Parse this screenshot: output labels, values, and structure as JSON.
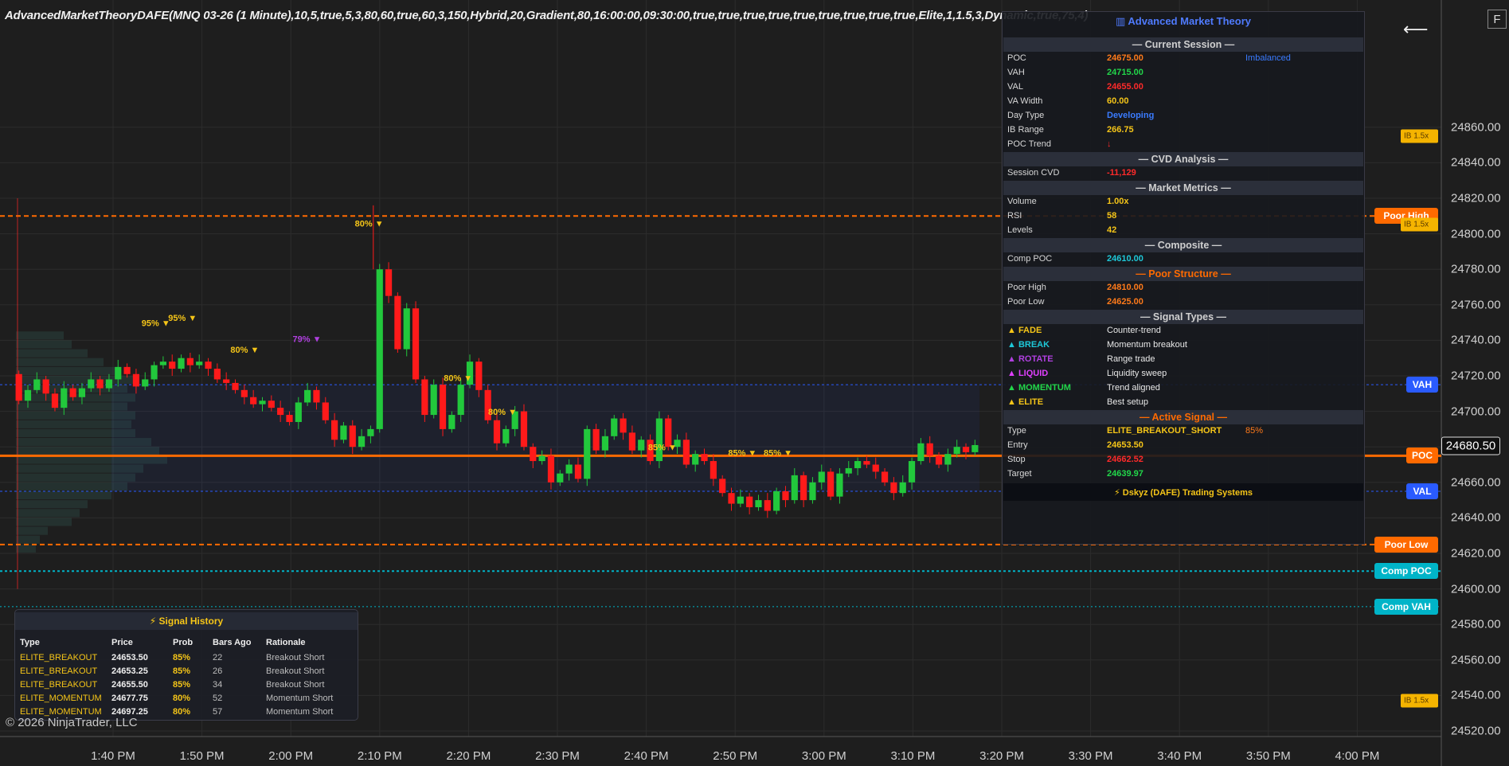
{
  "title": "AdvancedMarketTheoryDAFE(MNQ 03-26 (1 Minute),10,5,true,5,3,80,60,true,60,3,150,Hybrid,20,Gradient,80,16:00:00,09:30:00,true,true,true,true,true,true,true,true,true,Elite,1,1.5,3,Dynamic,true,75,4)",
  "copyright": "© 2026 NinjaTrader, LLC",
  "corner_button": "F",
  "time_axis": [
    "1:40 PM",
    "1:50 PM",
    "2:00 PM",
    "2:10 PM",
    "2:20 PM",
    "2:30 PM",
    "2:40 PM",
    "2:50 PM",
    "3:00 PM",
    "3:10 PM",
    "3:20 PM",
    "3:30 PM",
    "3:40 PM",
    "3:50 PM",
    "4:00 PM"
  ],
  "price_axis": [
    "24860.00",
    "24840.00",
    "24820.00",
    "24800.00",
    "24780.00",
    "24760.00",
    "24740.00",
    "24720.00",
    "24700.00",
    "24680.00",
    "24660.00",
    "24640.00",
    "24620.00",
    "24600.00",
    "24580.00",
    "24560.00",
    "24540.00",
    "24520.00"
  ],
  "last_price": "24680.50",
  "right_labels": [
    {
      "text": "Poor High",
      "price": 24810,
      "color": "#ff6a00"
    },
    {
      "text": "VAH",
      "price": 24715,
      "color": "#2a5bff"
    },
    {
      "text": "POC",
      "price": 24675,
      "color": "#ff6a00"
    },
    {
      "text": "VAL",
      "price": 24655,
      "color": "#2a5bff"
    },
    {
      "text": "Poor Low",
      "price": 24625,
      "color": "#ff6a00"
    },
    {
      "text": "Comp POC",
      "price": 24610,
      "color": "#00b4c8"
    },
    {
      "text": "Comp VAH",
      "price": 24590,
      "color": "#00b4c8"
    }
  ],
  "ib_labels": [
    {
      "text": "IB 1.5x",
      "price": 24855
    },
    {
      "text": "IB 1.5x",
      "price": 24805
    },
    {
      "text": "IB 1.5x",
      "price": 24537
    }
  ],
  "signal_markers": [
    {
      "text": "95% ▼",
      "price": 24748,
      "t": "1:45",
      "color": "#f5c518"
    },
    {
      "text": "95% ▼",
      "price": 24751,
      "t": "1:48",
      "color": "#f5c518"
    },
    {
      "text": "80% ▼",
      "price": 24733,
      "t": "1:55",
      "color": "#f5c518"
    },
    {
      "text": "79% ▼",
      "price": 24739,
      "t": "2:02",
      "color": "#b040e0"
    },
    {
      "text": "80% ▼",
      "price": 24804,
      "t": "2:09",
      "color": "#f5c518"
    },
    {
      "text": "80% ▼",
      "price": 24717,
      "t": "2:19",
      "color": "#f5c518"
    },
    {
      "text": "80% ▼",
      "price": 24698,
      "t": "2:24",
      "color": "#f5c518"
    },
    {
      "text": "85% ▼",
      "price": 24678,
      "t": "2:42",
      "color": "#f5c518"
    },
    {
      "text": "85% ▼",
      "price": 24675,
      "t": "2:51",
      "color": "#f5c518"
    },
    {
      "text": "85% ▼",
      "price": 24675,
      "t": "2:55",
      "color": "#f5c518"
    }
  ],
  "levels": {
    "poor_high": 24810,
    "poor_low": 24625,
    "vah": 24715,
    "val": 24655,
    "poc": 24675,
    "comp_poc": 24610,
    "comp_vah": 24590
  },
  "panel": {
    "title": "▥ Advanced Market Theory",
    "rows": [
      {
        "type": "section",
        "label": "— Current Session —",
        "color": "#cfcfcf"
      },
      {
        "k": "POC",
        "v": "24675.00",
        "vc": "#ff7a1a",
        "x": "Imbalanced",
        "xc": "#3a7bff"
      },
      {
        "k": "VAH",
        "v": "24715.00",
        "vc": "#22d64a"
      },
      {
        "k": "VAL",
        "v": "24655.00",
        "vc": "#ff2a2a"
      },
      {
        "k": "VA Width",
        "v": "60.00",
        "vc": "#f5c518"
      },
      {
        "k": "Day Type",
        "v": "Developing",
        "vc": "#3a7bff"
      },
      {
        "k": "IB Range",
        "v": "266.75",
        "vc": "#f5c518"
      },
      {
        "k": "POC Trend",
        "v": "↓",
        "vc": "#ff2a2a"
      },
      {
        "type": "section",
        "label": "— CVD Analysis —",
        "color": "#cfcfcf"
      },
      {
        "k": "Session CVD",
        "v": "-11,129",
        "vc": "#ff2a2a"
      },
      {
        "type": "section",
        "label": "— Market Metrics —",
        "color": "#cfcfcf"
      },
      {
        "k": "Volume",
        "v": "1.00x",
        "vc": "#f5c518"
      },
      {
        "k": "RSI",
        "v": "58",
        "vc": "#f5c518"
      },
      {
        "k": "Levels",
        "v": "42",
        "vc": "#f5c518"
      },
      {
        "type": "section",
        "label": "— Composite —",
        "color": "#cfcfcf"
      },
      {
        "k": "Comp POC",
        "v": "24610.00",
        "vc": "#1ec8d8"
      },
      {
        "type": "section",
        "label": "— Poor Structure —",
        "color": "#ff6a00"
      },
      {
        "k": "Poor High",
        "v": "24810.00",
        "vc": "#ff7a1a"
      },
      {
        "k": "Poor Low",
        "v": "24625.00",
        "vc": "#ff7a1a"
      },
      {
        "type": "section",
        "label": "— Signal Types —",
        "color": "#cfcfcf"
      },
      {
        "k": "▲ FADE",
        "kc": "#f5c518",
        "v": "Counter-trend",
        "vc": "#e8e8e8",
        "plain": true
      },
      {
        "k": "▲ BREAK",
        "kc": "#1ec8d8",
        "v": "Momentum breakout",
        "vc": "#e8e8e8",
        "plain": true
      },
      {
        "k": "▲ ROTATE",
        "kc": "#b040e0",
        "v": "Range trade",
        "vc": "#e8e8e8",
        "plain": true
      },
      {
        "k": "▲ LIQUID",
        "kc": "#e040ff",
        "v": "Liquidity sweep",
        "vc": "#e8e8e8",
        "plain": true
      },
      {
        "k": "▲ MOMENTUM",
        "kc": "#22d64a",
        "v": "Trend aligned",
        "vc": "#e8e8e8",
        "plain": true
      },
      {
        "k": "▲ ELITE",
        "kc": "#f5c518",
        "v": "Best setup",
        "vc": "#e8e8e8",
        "plain": true
      },
      {
        "type": "section",
        "label": "— Active Signal —",
        "color": "#ff6a00"
      },
      {
        "k": "Type",
        "v": "ELITE_BREAKOUT_SHORT",
        "vc": "#f5c518",
        "x": "85%",
        "xc": "#ff7a1a"
      },
      {
        "k": "Entry",
        "v": "24653.50",
        "vc": "#f5c518"
      },
      {
        "k": "Stop",
        "v": "24662.52",
        "vc": "#ff2a2a"
      },
      {
        "k": "Target",
        "v": "24639.97",
        "vc": "#22d64a"
      }
    ],
    "footer": "⚡ Dskyz (DAFE) Trading Systems"
  },
  "history": {
    "title": "⚡ Signal History",
    "columns": [
      "Type",
      "Price",
      "Prob",
      "Bars Ago",
      "Rationale"
    ],
    "rows": [
      [
        "ELITE_BREAKOUT",
        "24653.50",
        "85%",
        "22",
        "Breakout Short"
      ],
      [
        "ELITE_BREAKOUT",
        "24653.25",
        "85%",
        "26",
        "Breakout Short"
      ],
      [
        "ELITE_BREAKOUT",
        "24655.50",
        "85%",
        "34",
        "Breakout Short"
      ],
      [
        "ELITE_MOMENTUM",
        "24677.75",
        "80%",
        "52",
        "Momentum Short"
      ],
      [
        "ELITE_MOMENTUM",
        "24697.25",
        "80%",
        "57",
        "Momentum Short"
      ]
    ]
  },
  "colors": {
    "up": "#22c83c",
    "down": "#ff1a1a",
    "grid": "#2c2c2c",
    "accent": "#ff6a00",
    "value_area": "#2a5bff",
    "composite": "#00b4c8",
    "gold": "#f5c518"
  }
}
